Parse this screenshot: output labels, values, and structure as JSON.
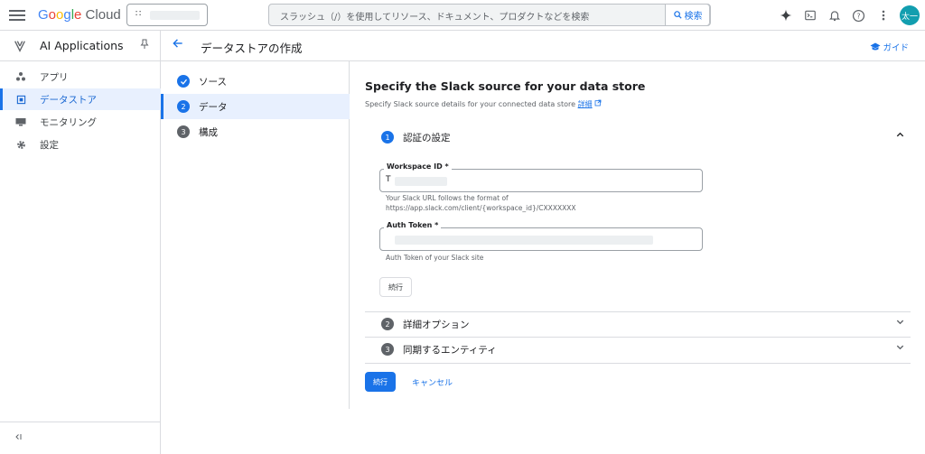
{
  "header": {
    "logo": {
      "google": [
        "G",
        "o",
        "o",
        "g",
        "l",
        "e"
      ],
      "cloud": " Cloud"
    },
    "search_placeholder": "スラッシュ（/）を使用してリソース、ドキュメント、プロダクトなどを検索",
    "search_button": "検索",
    "avatar_initials": "太一",
    "icons": [
      "gemini-spark-icon",
      "cloud-shell-icon",
      "notifications-icon",
      "help-icon",
      "more-vert-icon"
    ]
  },
  "sidebar": {
    "product_title": "AI Applications",
    "items": [
      {
        "label": "アプリ",
        "icon": "apps-icon"
      },
      {
        "label": "データストア",
        "icon": "datastore-icon",
        "active": true
      },
      {
        "label": "モニタリング",
        "icon": "monitoring-icon"
      },
      {
        "label": "設定",
        "icon": "settings-icon"
      }
    ]
  },
  "page": {
    "title": "データストアの作成",
    "guide": "ガイド"
  },
  "stepper": [
    {
      "num": "✓",
      "label": "ソース",
      "state": "done"
    },
    {
      "num": "2",
      "label": "データ",
      "state": "active"
    },
    {
      "num": "3",
      "label": "構成",
      "state": "todo"
    }
  ],
  "form": {
    "title": "Specify the Slack source for your data store",
    "subtitle": "Specify Slack source details for your connected data store",
    "subtitle_link": "詳細",
    "sections": [
      {
        "num": "1",
        "title": "認証の設定"
      },
      {
        "num": "2",
        "title": "詳細オプション"
      },
      {
        "num": "3",
        "title": "同期するエンティティ"
      }
    ],
    "workspace": {
      "label": "Workspace ID *",
      "value": "T",
      "hint_line1": "Your Slack URL follows the format of",
      "hint_line2": "https://app.slack.com/client/{workspace_id}/CXXXXXXX"
    },
    "token": {
      "label": "Auth Token *",
      "hint": "Auth Token of your Slack site"
    },
    "continue_inner": "続行",
    "continue": "続行",
    "cancel": "キャンセル"
  },
  "colors": {
    "accent": "#1a73e8",
    "active_bg": "#e8f0fe",
    "avatar": "#129eaf"
  }
}
